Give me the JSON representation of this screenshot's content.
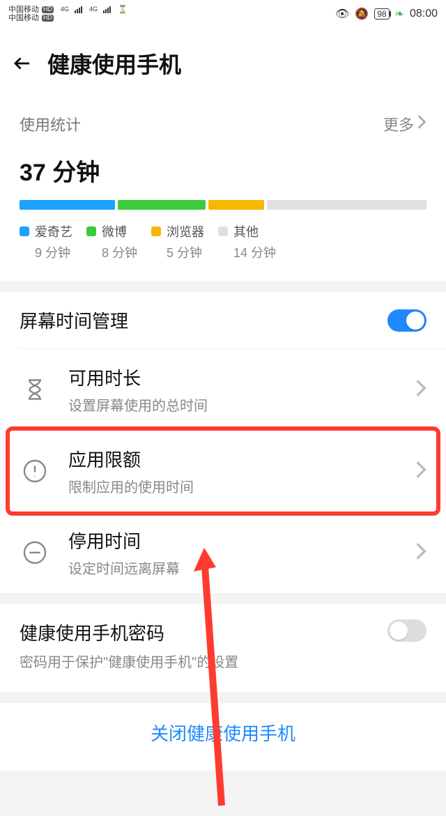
{
  "status": {
    "carrier": "中国移动",
    "net": "4G",
    "battery": "98",
    "time": "08:00"
  },
  "header": {
    "title": "健康使用手机"
  },
  "usage": {
    "section_label": "使用统计",
    "more": "更多",
    "total": "37 分钟",
    "apps": [
      {
        "name": "爱奇艺",
        "time": "9 分钟",
        "color": "#1aa3ff",
        "pct": 24
      },
      {
        "name": "微博",
        "time": "8 分钟",
        "color": "#3bcc3b",
        "pct": 22
      },
      {
        "name": "浏览器",
        "time": "5 分钟",
        "color": "#f5b700",
        "pct": 14
      },
      {
        "name": "其他",
        "time": "14 分钟",
        "color": "#e0e0e0",
        "pct": 40
      }
    ]
  },
  "screen_mgmt": {
    "label": "屏幕时间管理",
    "on": true
  },
  "rows": {
    "available": {
      "title": "可用时长",
      "sub": "设置屏幕使用的总时间"
    },
    "quota": {
      "title": "应用限额",
      "sub": "限制应用的使用时间"
    },
    "downtime": {
      "title": "停用时间",
      "sub": "设定时间远离屏幕"
    }
  },
  "password": {
    "title": "健康使用手机密码",
    "sub": "密码用于保护\"健康使用手机\"的设置",
    "on": false
  },
  "bottom": {
    "close": "关闭健康使用手机"
  }
}
